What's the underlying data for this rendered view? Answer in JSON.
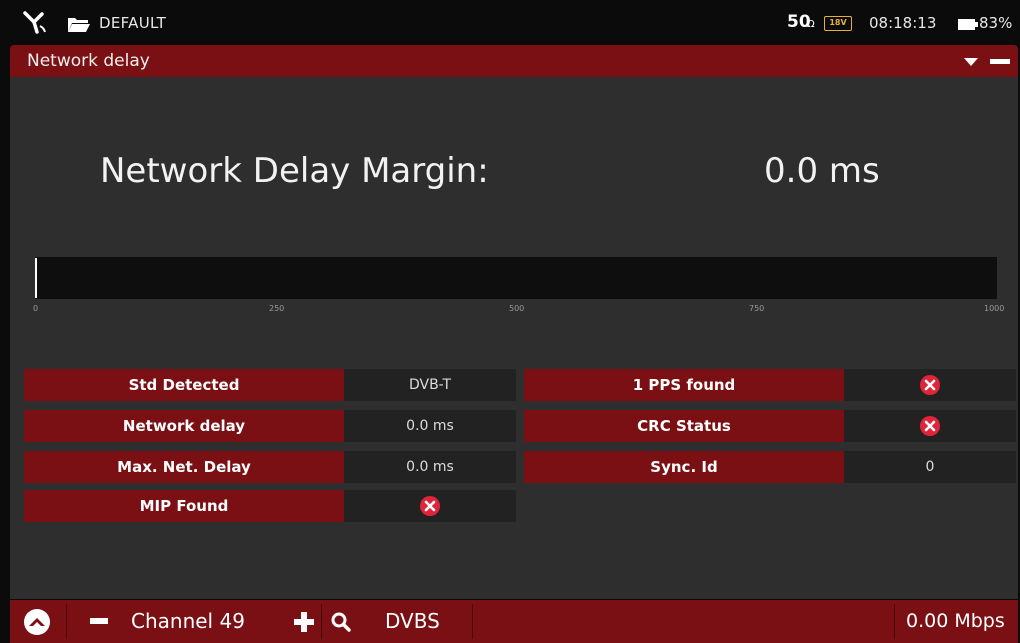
{
  "statusbar": {
    "profile": "DEFAULT",
    "impedance_value": "50",
    "impedance_unit": "Ω",
    "voltage_badge": "18V",
    "time": "08:18:13",
    "battery": "83%"
  },
  "window": {
    "title": "Network delay"
  },
  "main": {
    "margin_label": "Network Delay Margin:",
    "margin_value": "0.0 ms",
    "bar": {
      "level": 0,
      "scale_max": 1000,
      "ticks": [
        "0",
        "250",
        "500",
        "750",
        "1000"
      ]
    },
    "rows_left": [
      {
        "label": "Std Detected",
        "value": "DVB-T"
      },
      {
        "label": "Network delay",
        "value": "0.0 ms"
      },
      {
        "label": "Max. Net. Delay",
        "value": "0.0 ms"
      },
      {
        "label": "MIP Found",
        "value": "",
        "status": "fail"
      }
    ],
    "rows_right": [
      {
        "label": "1 PPS found",
        "value": "",
        "status": "fail"
      },
      {
        "label": "CRC Status",
        "value": "",
        "status": "fail"
      },
      {
        "label": "Sync. Id",
        "value": "0"
      }
    ]
  },
  "bottombar": {
    "channel": "Channel 49",
    "standard": "DVBS",
    "bitrate": "0.00 Mbps"
  },
  "colors": {
    "accent": "#7a1014",
    "panel": "#2e2e2e",
    "fail_icon": "#e0243a"
  },
  "icons": {
    "satellite": "satellite-icon",
    "folder": "folder-icon",
    "battery": "battery-icon",
    "dropdown": "dropdown-icon",
    "minimize": "minimize-icon",
    "fail": "fail-x-icon",
    "home": "home-icon",
    "minus": "minus-icon",
    "plus": "plus-icon",
    "search": "search-icon"
  }
}
